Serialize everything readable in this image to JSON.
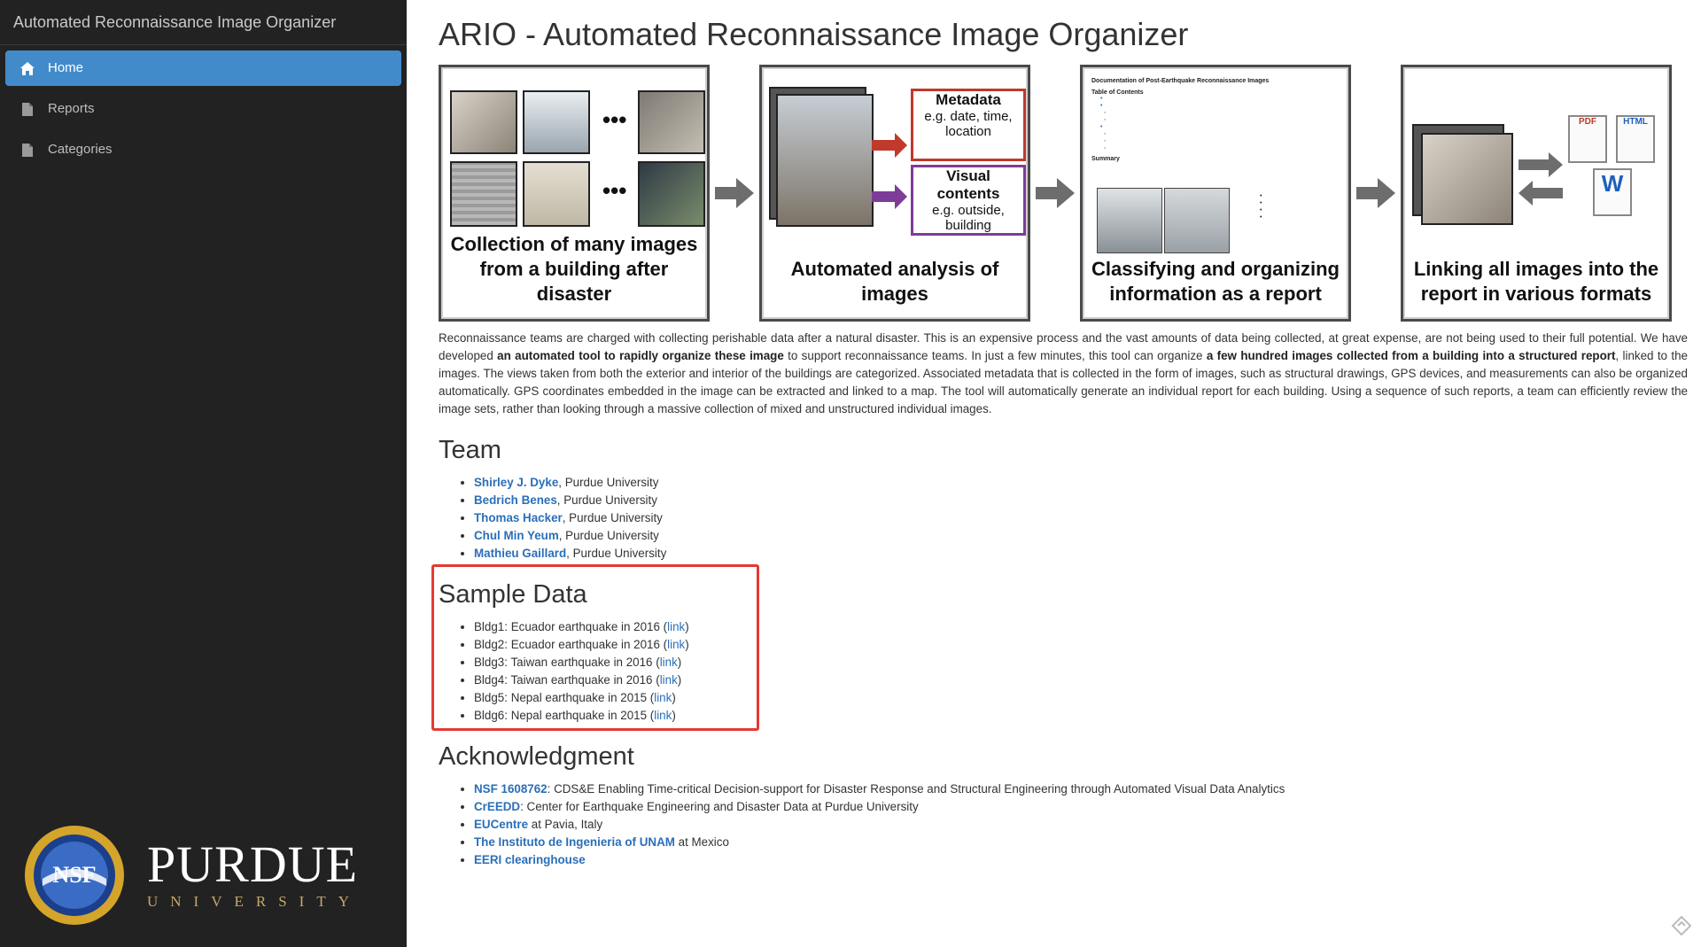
{
  "sidebar": {
    "brand": "Automated Reconnaissance Image Organizer",
    "items": [
      {
        "label": "Home",
        "icon": "home-icon",
        "active": true
      },
      {
        "label": "Reports",
        "icon": "file-icon",
        "active": false
      },
      {
        "label": "Categories",
        "icon": "file-icon",
        "active": false
      }
    ],
    "logos": {
      "nsf": "NSF",
      "purdue_big": "PURDUE",
      "purdue_small": "UNIVERSITY"
    }
  },
  "main": {
    "title": "ARIO - Automated Reconnaissance Image Organizer",
    "figure": {
      "panels": [
        {
          "caption": "Collection of many images from a building after disaster"
        },
        {
          "caption": "Automated analysis of images",
          "metadata_title": "Metadata",
          "metadata_text": "e.g. date, time, location",
          "visual_title": "Visual contents",
          "visual_text": "e.g. outside, building"
        },
        {
          "caption": "Classifying and organizing information as a report",
          "doc_title": "Documentation of Post-Earthquake Reconnaissance Images",
          "doc_toc": "Table of Contents",
          "doc_summary": "Summary"
        },
        {
          "caption": "Linking all images into the report in various formats",
          "formats": [
            "PDF",
            "HTML",
            "W"
          ]
        }
      ]
    },
    "description": {
      "p1": "Reconnaissance teams are charged with collecting perishable data after a natural disaster. This is an expensive process and the vast amounts of data being collected, at great expense, are not being used to their full potential. We have developed ",
      "b1": "an automated tool to rapidly organize these image",
      "p2": " to support reconnaissance teams. In just a few minutes, this tool can organize ",
      "b2": "a few hundred images collected from a building into a structured report",
      "p3": ", linked to the images. The views taken from both the exterior and interior of the buildings are categorized. Associated metadata that is collected in the form of images, such as structural drawings, GPS devices, and measurements can also be organized automatically. GPS coordinates embedded in the image can be extracted and linked to a map. The tool will automatically generate an individual report for each building. Using a sequence of such reports, a team can efficiently review the image sets, rather than looking through a massive collection of mixed and unstructured individual images."
    },
    "team": {
      "heading": "Team",
      "members": [
        {
          "name": "Shirley J. Dyke",
          "affil": ", Purdue University"
        },
        {
          "name": "Bedrich Benes",
          "affil": ", Purdue University"
        },
        {
          "name": "Thomas Hacker",
          "affil": ", Purdue University"
        },
        {
          "name": "Chul Min Yeum",
          "affil": ", Purdue University"
        },
        {
          "name": "Mathieu Gaillard",
          "affil": ", Purdue University"
        }
      ]
    },
    "sample": {
      "heading": "Sample Data",
      "items": [
        {
          "text": "Bldg1: Ecuador earthquake in 2016 (",
          "link": "link",
          "end": ")"
        },
        {
          "text": "Bldg2: Ecuador earthquake in 2016 (",
          "link": "link",
          "end": ")"
        },
        {
          "text": "Bldg3: Taiwan earthquake in 2016 (",
          "link": "link",
          "end": ")"
        },
        {
          "text": "Bldg4: Taiwan earthquake in 2016 (",
          "link": "link",
          "end": ")"
        },
        {
          "text": "Bldg5: Nepal earthquake in 2015 (",
          "link": "link",
          "end": ")"
        },
        {
          "text": "Bldg6: Nepal earthquake in 2015 (",
          "link": "link",
          "end": ")"
        }
      ]
    },
    "ack": {
      "heading": "Acknowledgment",
      "items": [
        {
          "link": "NSF 1608762",
          "text": ": CDS&E Enabling Time-critical Decision-support for Disaster Response and Structural Engineering through Automated Visual Data Analytics"
        },
        {
          "link": "CrEEDD",
          "text": ": Center for Earthquake Engineering and Disaster Data at Purdue University"
        },
        {
          "link": "EUCentre",
          "text": " at Pavia, Italy"
        },
        {
          "link": "The Instituto de Ingenieria of UNAM",
          "text": " at Mexico"
        },
        {
          "link": "EERI clearinghouse",
          "text": ""
        }
      ]
    }
  },
  "colors": {
    "sidebar_bg": "#222222",
    "active": "#428bca",
    "link": "#2a6fb8",
    "highlight": "#e53935"
  }
}
